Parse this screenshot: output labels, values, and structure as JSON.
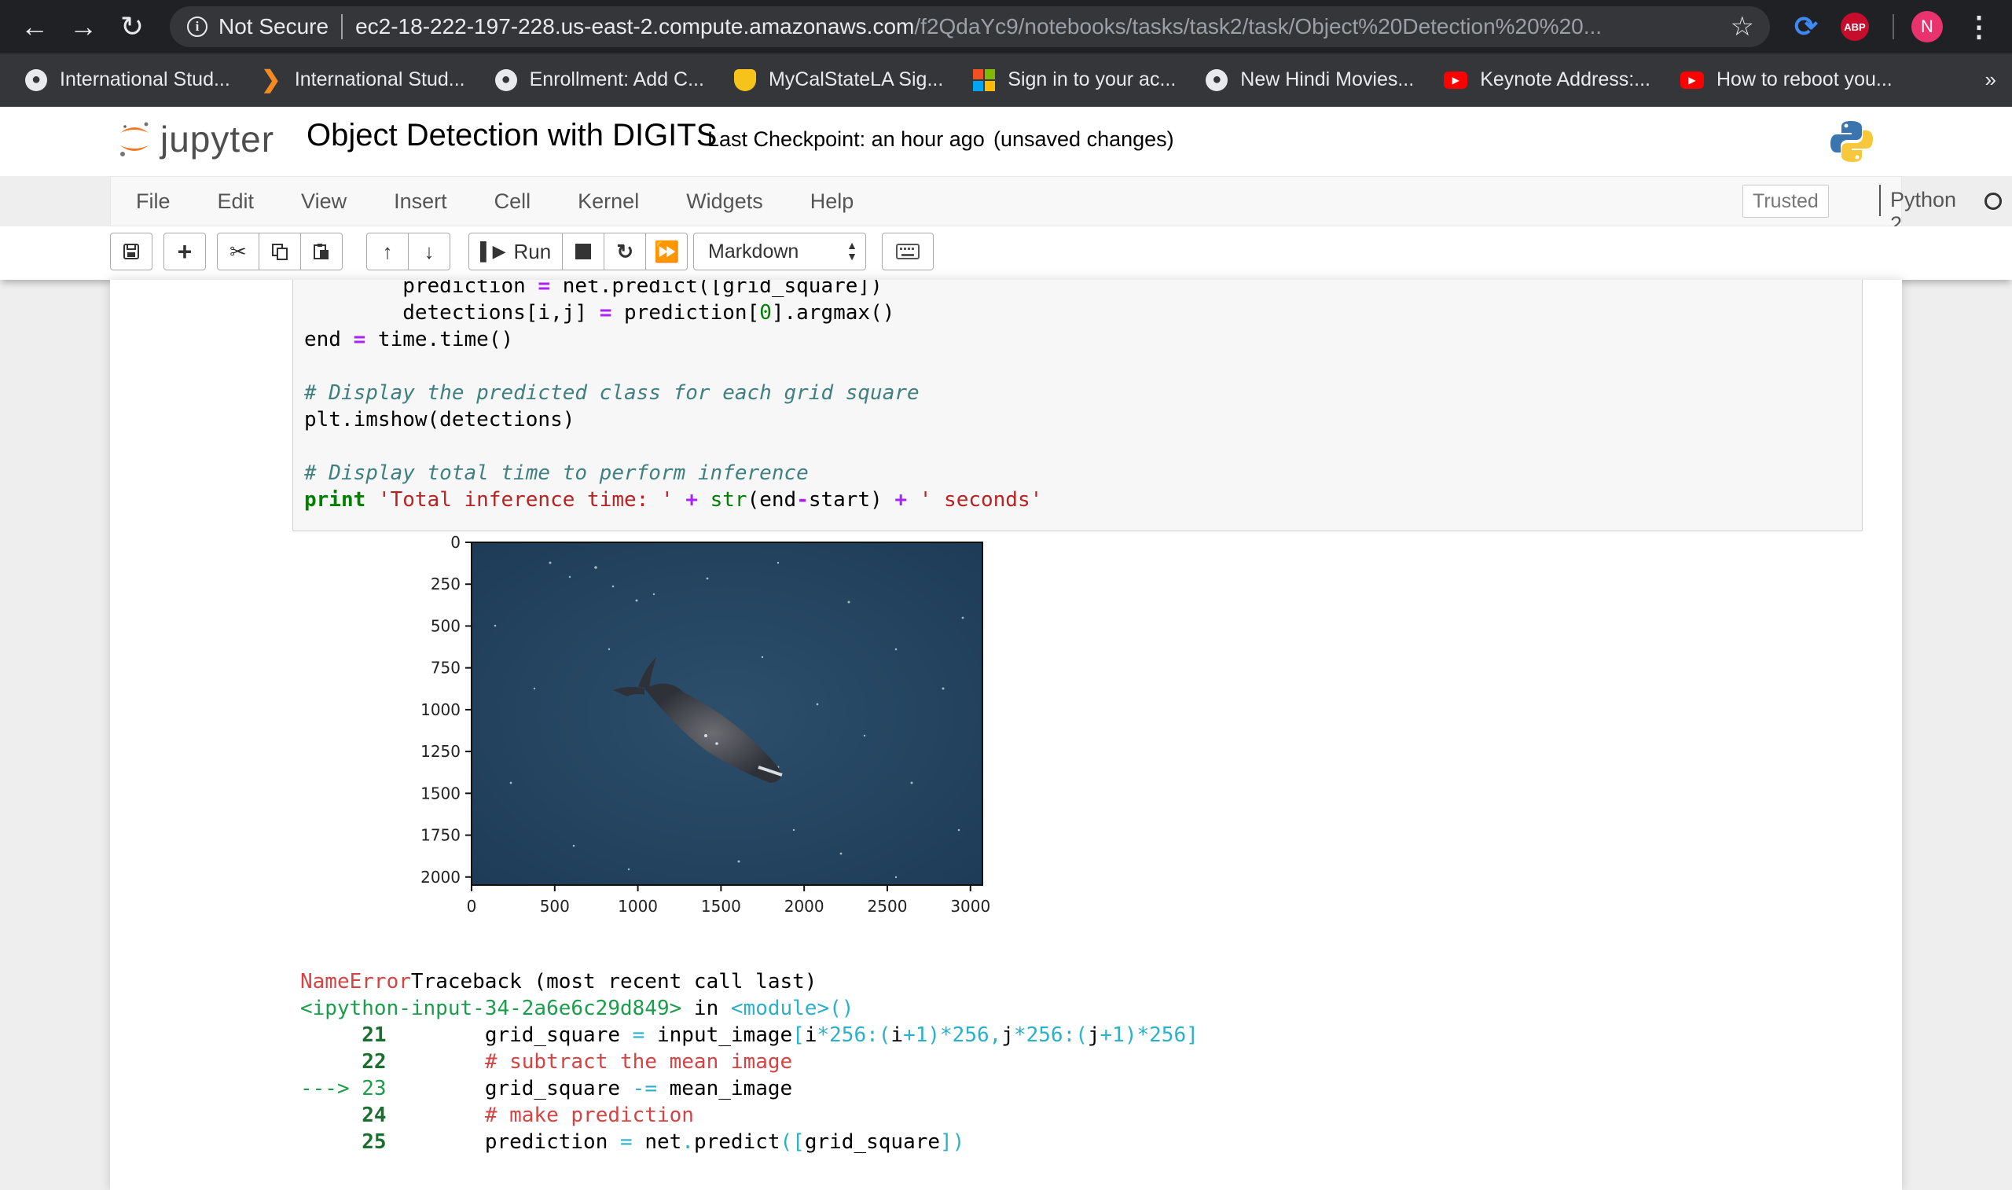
{
  "browser": {
    "security_label": "Not Secure",
    "url_host": "ec2-18-222-197-228.us-east-2.compute.amazonaws.com",
    "url_path": "/f2QdaYc9/notebooks/tasks/task2/task/Object%20Detection%20%20...",
    "abp_label": "ABP",
    "profile_initial": "N",
    "bookmarks": [
      {
        "label": "International Stud...",
        "icon": "globe-icon"
      },
      {
        "label": "International Stud...",
        "icon": "orange-logo-icon"
      },
      {
        "label": "Enrollment: Add C...",
        "icon": "globe-icon"
      },
      {
        "label": "MyCalStateLA Sig...",
        "icon": "shield-icon"
      },
      {
        "label": "Sign in to your ac...",
        "icon": "microsoft-icon"
      },
      {
        "label": "New Hindi Movies...",
        "icon": "globe-icon"
      },
      {
        "label": "Keynote Address:...",
        "icon": "youtube-icon"
      },
      {
        "label": "How to reboot you...",
        "icon": "youtube-icon"
      }
    ],
    "more_label": "»"
  },
  "jupyter": {
    "logo_text": "jupyter",
    "notebook_title": "Object Detection with DIGITS",
    "checkpoint": "Last Checkpoint: an hour ago",
    "unsaved": "(unsaved changes)",
    "menu": [
      "File",
      "Edit",
      "View",
      "Insert",
      "Cell",
      "Kernel",
      "Widgets",
      "Help"
    ],
    "trusted_label": "Trusted",
    "kernel_name": "Python 2",
    "toolbar": {
      "run_label": "Run",
      "cell_type": "Markdown"
    }
  },
  "code_cell": {
    "lines": [
      "        prediction = net.predict([grid_square])",
      "        detections[i,j] = prediction[0].argmax()",
      "end = time.time()",
      "",
      "# Display the predicted class for each grid square",
      "plt.imshow(detections)",
      "",
      "# Display total time to perform inference",
      "print 'Total inference time: ' + str(end-start) + ' seconds'"
    ]
  },
  "plot": {
    "y_ticks": [
      "0",
      "250",
      "500",
      "750",
      "1000",
      "1250",
      "1500",
      "1750",
      "2000"
    ],
    "x_ticks": [
      "0",
      "500",
      "1000",
      "1500",
      "2000",
      "2500",
      "3000"
    ]
  },
  "traceback": {
    "error_name": "NameError",
    "header_rest": "Traceback (most recent call last)",
    "input_ref": "<ipython-input-34-2a6e6c29d849>",
    "in_word": " in ",
    "module_ref": "<module>()",
    "lines": [
      {
        "marker": "     ",
        "num": "21",
        "code": "        grid_square = input_image[i*256:(i+1)*256,j*256:(j+1)*256]"
      },
      {
        "marker": "     ",
        "num": "22",
        "code": "        # subtract the mean image"
      },
      {
        "marker": "---> ",
        "num": "23",
        "code": "        grid_square -= mean_image"
      },
      {
        "marker": "     ",
        "num": "24",
        "code": "        # make prediction"
      },
      {
        "marker": "     ",
        "num": "25",
        "code": "        prediction = net.predict([grid_square])"
      }
    ]
  }
}
